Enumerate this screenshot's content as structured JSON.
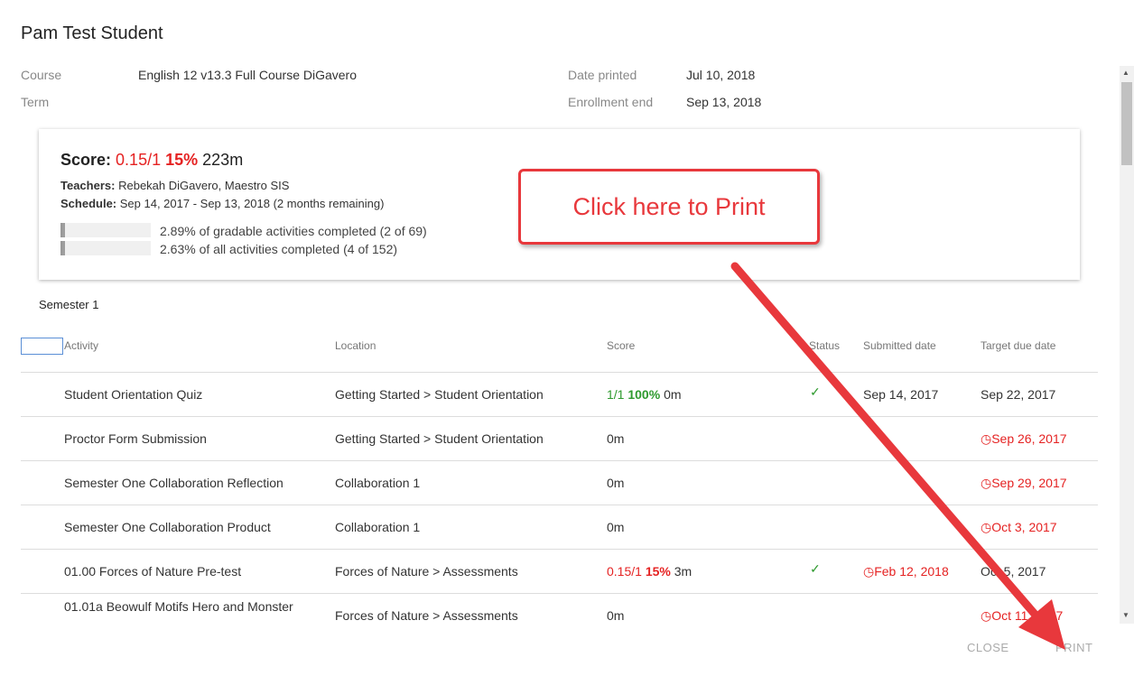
{
  "student_name": "Pam Test Student",
  "meta": {
    "course_label": "Course",
    "course_value": "English 12 v13.3 Full Course DiGavero",
    "term_label": "Term",
    "date_printed_label": "Date printed",
    "date_printed_value": "Jul 10, 2018",
    "enrollment_end_label": "Enrollment end",
    "enrollment_end_value": "Sep 13, 2018"
  },
  "summary": {
    "score_label": "Score:",
    "score_fraction": "0.15/1",
    "score_percent": "15%",
    "score_time": "223m",
    "teachers_label": "Teachers:",
    "teachers_value": "Rebekah DiGavero, Maestro SIS",
    "schedule_label": "Schedule:",
    "schedule_value": "Sep 14, 2017 - Sep 13, 2018 (2 months remaining)",
    "progress": [
      {
        "fraction": 0.0289,
        "text": "2.89% of gradable activities completed (2 of 69)"
      },
      {
        "fraction": 0.0263,
        "text": "2.63% of all activities completed (4 of 152)"
      }
    ]
  },
  "semester_title": "Semester 1",
  "table": {
    "headers": {
      "activity": "Activity",
      "location": "Location",
      "score": "Score",
      "status": "Status",
      "submitted": "Submitted date",
      "target": "Target due date"
    },
    "rows": [
      {
        "activity": "Student Orientation Quiz",
        "location": "Getting Started > Student Orientation",
        "score_fraction": "1/1",
        "score_percent": "100%",
        "score_time": "0m",
        "score_color": "green",
        "status": "✓",
        "submitted": "Sep 14, 2017",
        "submitted_late": false,
        "target": "Sep 22, 2017",
        "target_overdue": false
      },
      {
        "activity": "Proctor Form Submission",
        "location": "Getting Started > Student Orientation",
        "score_fraction": "",
        "score_percent": "",
        "score_time": "0m",
        "score_color": "",
        "status": "",
        "submitted": "",
        "submitted_late": false,
        "target": "Sep 26, 2017",
        "target_overdue": true
      },
      {
        "activity": "Semester One Collaboration Reflection",
        "location": "Collaboration 1",
        "score_fraction": "",
        "score_percent": "",
        "score_time": "0m",
        "score_color": "",
        "status": "",
        "submitted": "",
        "submitted_late": false,
        "target": "Sep 29, 2017",
        "target_overdue": true
      },
      {
        "activity": "Semester One Collaboration Product",
        "location": "Collaboration 1",
        "score_fraction": "",
        "score_percent": "",
        "score_time": "0m",
        "score_color": "",
        "status": "",
        "submitted": "",
        "submitted_late": false,
        "target": "Oct 3, 2017",
        "target_overdue": true
      },
      {
        "activity": "01.00 Forces of Nature Pre-test",
        "location": "Forces of Nature > Assessments",
        "score_fraction": "0.15/1",
        "score_percent": "15%",
        "score_time": "3m",
        "score_color": "red",
        "status": "✓",
        "submitted": "Feb 12, 2018",
        "submitted_late": true,
        "target": "Oct 5, 2017",
        "target_overdue": false
      },
      {
        "activity": "01.01a Beowulf Motifs Hero and Monster",
        "location": "Forces of Nature > Assessments",
        "score_fraction": "",
        "score_percent": "",
        "score_time": "0m",
        "score_color": "",
        "status": "",
        "submitted": "",
        "submitted_late": false,
        "target": "Oct 11, 2017",
        "target_overdue": true
      }
    ]
  },
  "actions": {
    "close": "CLOSE",
    "print": "PRINT"
  },
  "callout": "Click here to Print",
  "colors": {
    "red": "#e52222",
    "green": "#2e9a2e",
    "callout": "#e8383c"
  },
  "icons": {
    "clock": "clock-icon",
    "check": "checkmark-icon"
  }
}
